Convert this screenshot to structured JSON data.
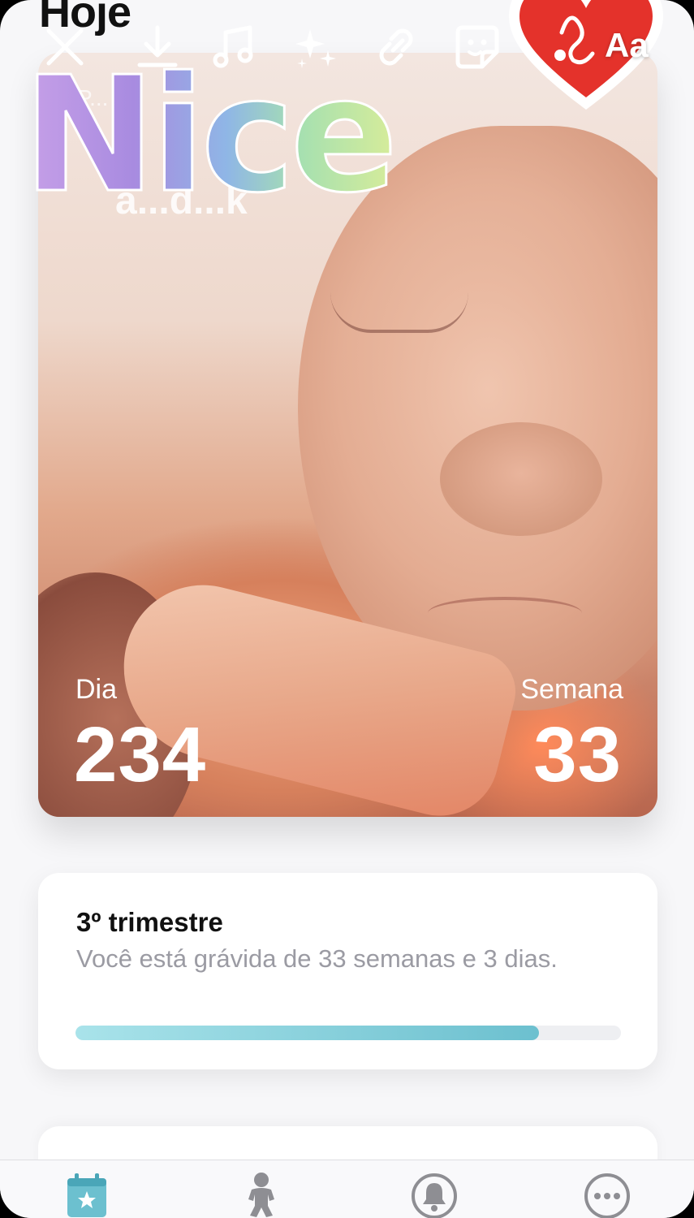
{
  "app": {
    "page_title": "Hoje"
  },
  "hero": {
    "faded_label": "P... ",
    "faded_name": "a...d...k",
    "day_label": "Dia",
    "day_value": "234",
    "week_label": "Semana",
    "week_value": "33"
  },
  "trimester": {
    "title": "3º trimestre",
    "description": "Você está grávida de 33 semanas e 3 dias.",
    "progress": 0.85
  },
  "story_toolbar": {
    "icons": [
      "close-icon",
      "download-icon",
      "music-icon",
      "effects-icon",
      "link-icon",
      "sticker-icon"
    ],
    "text_tool_label": "Aa"
  },
  "stickers": {
    "nice_text": "Nice",
    "heart_color": "#e4322b"
  },
  "tabbar": {
    "icons": [
      "calendar-star-icon",
      "baby-icon",
      "bell-icon",
      "more-icon"
    ],
    "active_color": "#6cc0cf",
    "inactive_color": "#8e8e93"
  }
}
